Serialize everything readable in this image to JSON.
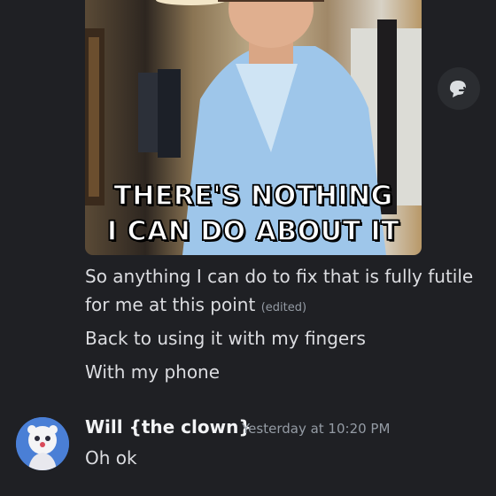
{
  "gif": {
    "caption_line1": "THERE'S NOTHING",
    "caption_line2": "I CAN DO ABOUT IT"
  },
  "side_button": {
    "icon": "forward-reply-icon"
  },
  "messages_prev": [
    {
      "text": "So anything I can do to fix that is fully futile",
      "continuation": "for me at this point",
      "edited_label": "(edited)"
    },
    {
      "text": "Back to using it with my fingers"
    },
    {
      "text": "With my phone"
    }
  ],
  "next_group": {
    "username": "Will {the clown}",
    "timestamp": "Yesterday at 10:20 PM",
    "message": "Oh ok"
  },
  "colors": {
    "background": "#1f2024",
    "text": "#dcdde1",
    "muted": "#949ba4"
  }
}
